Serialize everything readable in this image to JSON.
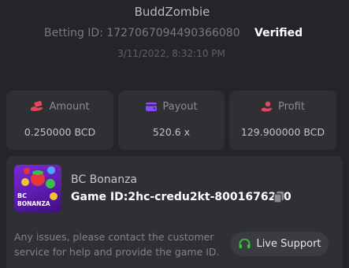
{
  "header": {
    "username": "BuddZombie",
    "betting_label": "Betting ID: 1727067094490366080",
    "verified": "Verified",
    "timestamp": "3/11/2022, 8:32:10 PM"
  },
  "stats": {
    "amount": {
      "label": "Amount",
      "value": "0.250000 BCD",
      "icon": "money-hand-icon",
      "color": "#e8465f"
    },
    "payout": {
      "label": "Payout",
      "value": "520.6 x",
      "icon": "wallet-icon",
      "color": "#8a4cff"
    },
    "profit": {
      "label": "Profit",
      "value": "129.900000 BCD",
      "icon": "profit-hand-icon",
      "color": "#e8465f"
    }
  },
  "game": {
    "name": "BC Bonanza",
    "id_text": "Game ID:2hc-credu2kt-8001676230",
    "thumb_brand": "BC",
    "thumb_title": "BONANZA"
  },
  "support": {
    "issues_text": "Any issues, please contact the customer service for help and provide the game ID.",
    "button_label": "Live Support",
    "accent": "#3fbf3f"
  }
}
